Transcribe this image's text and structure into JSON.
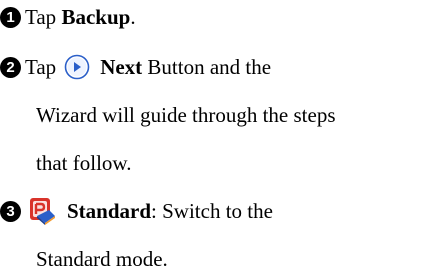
{
  "steps": [
    {
      "number": "1",
      "pre": "Tap ",
      "bold": "Backup",
      "post": "."
    },
    {
      "number": "2",
      "pre": "Tap",
      "icon": "next-button-icon",
      "bold": "Next",
      "post": " Button and the",
      "continuation": [
        "Wizard will guide through the steps",
        "that follow."
      ]
    },
    {
      "number": "3",
      "icon": "standard-mode-app-icon",
      "bold": "Standard",
      "post": ": Switch to the",
      "continuation": [
        "Standard mode."
      ]
    }
  ],
  "colors": {
    "text": "#000000",
    "icon_blue": "#2b5fc9",
    "icon_red": "#d9332b",
    "icon_orange": "#f29a2e"
  }
}
